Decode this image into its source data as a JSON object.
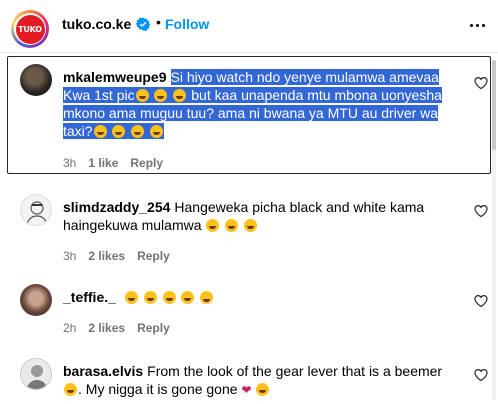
{
  "header": {
    "logo_text": "TUKO",
    "handle": "tuko.co.ke",
    "separator": "•",
    "follow_label": "Follow"
  },
  "comments": [
    {
      "username": "mkalemweupe9",
      "text_lines": [
        "Si hiyo watch ndo yenye mulamwa amevaa",
        "Kwa 1st pic",
        "but kaa unapenda mtu mbona uonyesha",
        "mkono ama muguu tuu? ama ni bwana ya MTU au driver wa",
        "taxi?"
      ],
      "time": "3h",
      "likes": "1 like",
      "reply": "Reply"
    },
    {
      "username": "slimdzaddy_254",
      "text_lines": [
        "Hangeweka picha black and white kama",
        "haingekuwa mulamwa"
      ],
      "time": "3h",
      "likes": "2 likes",
      "reply": "Reply"
    },
    {
      "username": "_teffie._",
      "text_lines": [
        ""
      ],
      "time": "2h",
      "likes": "2 likes",
      "reply": "Reply"
    },
    {
      "username": "barasa.elvis",
      "text_lines": [
        "From the look of the gear lever that is a beemer",
        ". My nigga it is gone gone"
      ],
      "time": "",
      "likes": "",
      "reply": ""
    }
  ],
  "colors": {
    "accent": "#0095f6",
    "selection": "#3367d6",
    "brand": "#e31b23",
    "meta": "#737373"
  }
}
